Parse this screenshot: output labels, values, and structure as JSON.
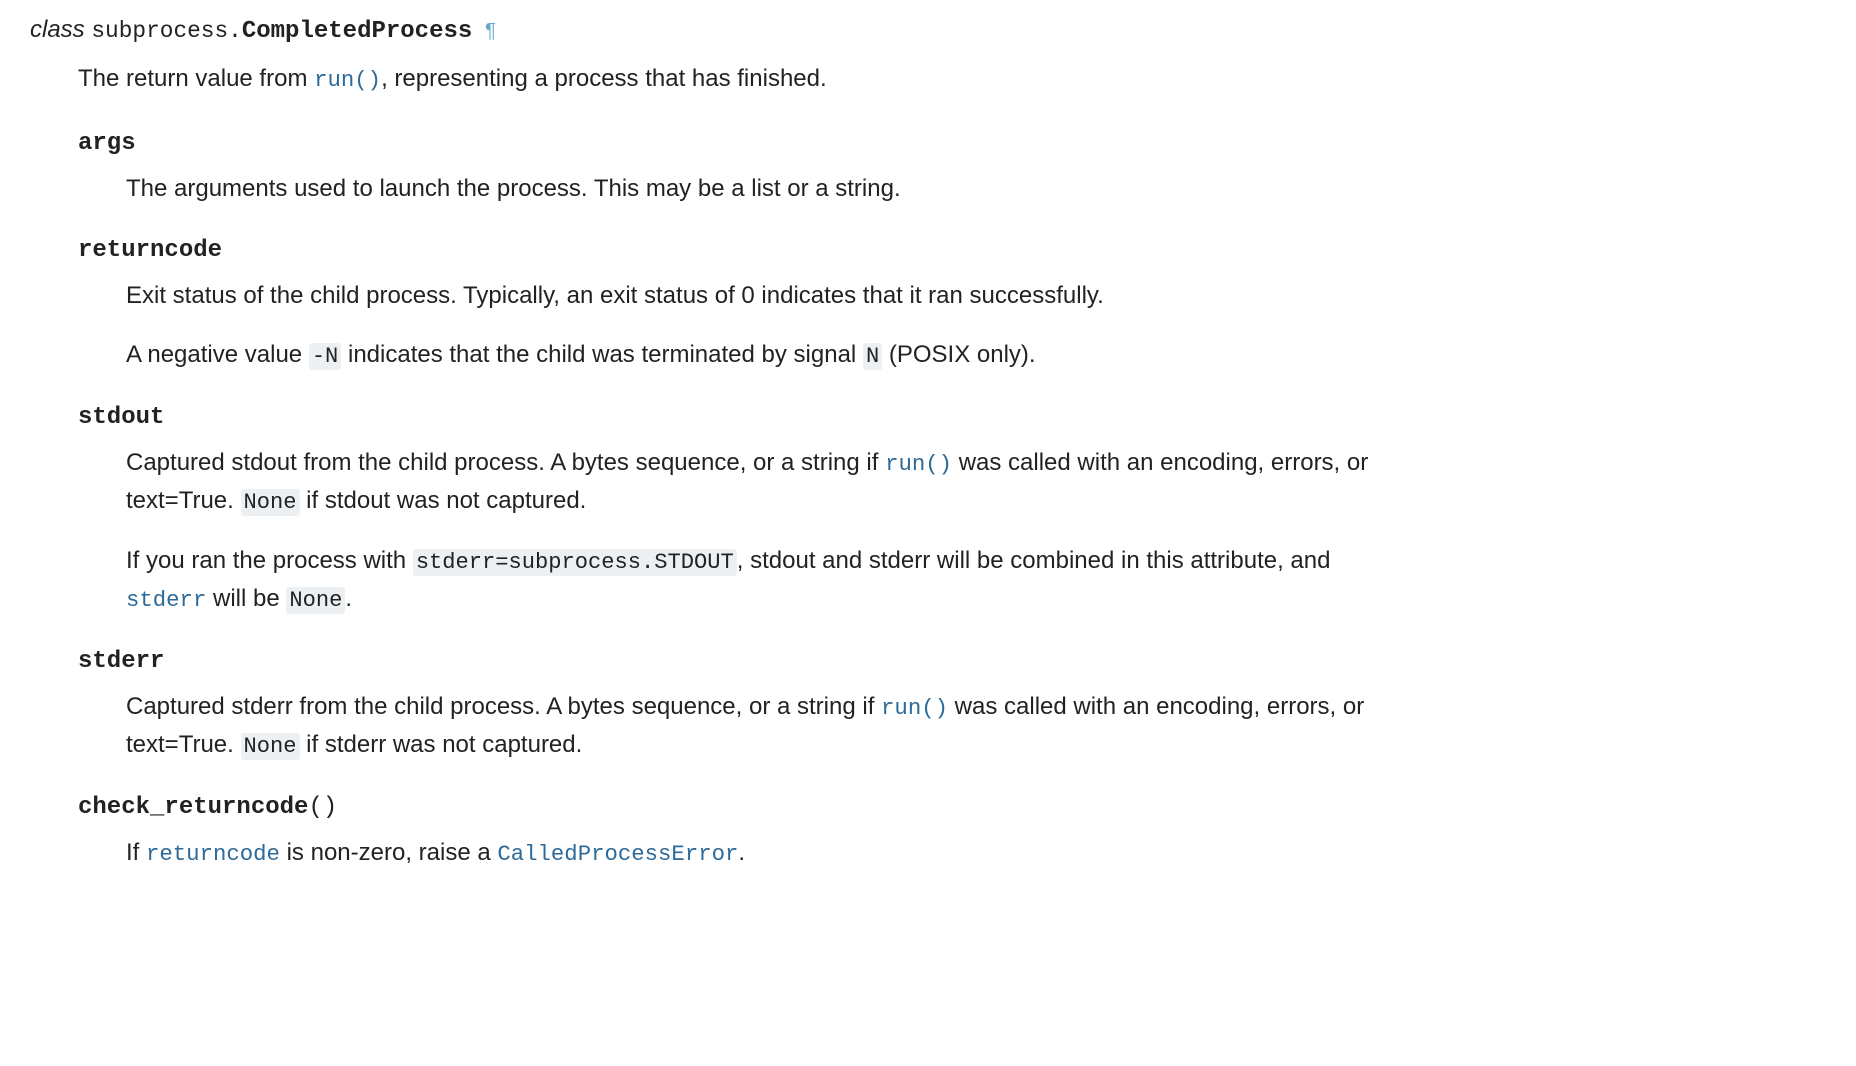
{
  "class_sig": {
    "keyword": "class",
    "module": "subprocess.",
    "name": "CompletedProcess",
    "permalink": "¶"
  },
  "class_desc_parts": {
    "pre": "The return value from ",
    "link_run": "run()",
    "post": ", representing a process that has finished."
  },
  "attrs": {
    "args": {
      "name": "args",
      "p1": "The arguments used to launch the process. This may be a list or a string."
    },
    "returncode": {
      "name": "returncode",
      "p1": "Exit status of the child process. Typically, an exit status of 0 indicates that it ran successfully.",
      "p2_pre": "A negative value ",
      "p2_code_negn": "-N",
      "p2_mid": " indicates that the child was terminated by signal ",
      "p2_code_n": "N",
      "p2_post": " (POSIX only)."
    },
    "stdout": {
      "name": "stdout",
      "p1_pre": "Captured stdout from the child process. A bytes sequence, or a string if ",
      "p1_link_run": "run()",
      "p1_mid": " was called with an encoding, errors, or text=True. ",
      "p1_code_none": "None",
      "p1_post": " if stdout was not captured.",
      "p2_pre": "If you ran the process with ",
      "p2_code_stderr_arg": "stderr=subprocess.STDOUT",
      "p2_mid1": ", stdout and stderr will be combined in this attribute, and ",
      "p2_link_stderr": "stderr",
      "p2_mid2": " will be ",
      "p2_code_none": "None",
      "p2_post": "."
    },
    "stderr": {
      "name": "stderr",
      "p1_pre": "Captured stderr from the child process. A bytes sequence, or a string if ",
      "p1_link_run": "run()",
      "p1_mid": " was called with an encoding, errors, or text=True. ",
      "p1_code_none": "None",
      "p1_post": " if stderr was not captured."
    },
    "check_returncode": {
      "name": "check_returncode",
      "parens": "()",
      "p1_pre": "If ",
      "p1_link_returncode": "returncode",
      "p1_mid": " is non-zero, raise a ",
      "p1_link_cpe": "CalledProcessError",
      "p1_post": "."
    }
  }
}
